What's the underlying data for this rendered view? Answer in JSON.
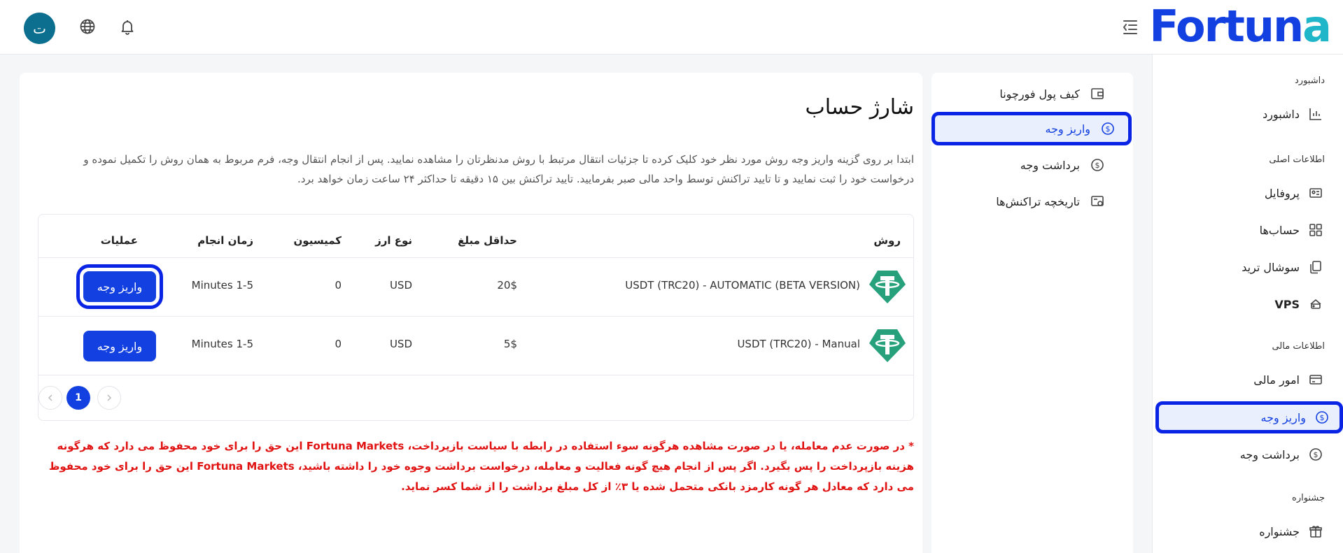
{
  "brand": {
    "logo_text": "Fortuna"
  },
  "header": {
    "avatar_glyph": "ت"
  },
  "sidebar": {
    "sections": {
      "dashboard": "داشبورد",
      "basic_info": "اطلاعات اصلی",
      "financial_info": "اطلاعات مالی",
      "festival": "جشنواره"
    },
    "items": {
      "dashboard": "داشبورد",
      "profile": "پروفایل",
      "accounts": "حساب‌ها",
      "social_trade": "سوشال ترید",
      "vps": "VPS",
      "financial_affairs": "امور مالی",
      "deposit": "واریز وجه",
      "withdraw": "برداشت وجه",
      "festival": "جشنواره"
    }
  },
  "subnav": {
    "wallet": "کیف پول فورچونا",
    "deposit": "واریز وجه",
    "withdraw": "برداشت وجه",
    "transactions": "تاریخچه تراکنش‌ها"
  },
  "page": {
    "title": "شارژ حساب",
    "description": "ابتدا بر روی گزینه واریز وجه روش مورد نظر خود کلیک کرده تا جزئیات انتقال مرتبط با روش مدنظرتان را مشاهده نمایید. پس از انجام انتقال وجه، فرم مربوط به همان روش را تکمیل نموده و درخواست خود را ثبت نمایید و تا تایید تراکنش توسط واحد مالی صبر بفرمایید. تایید تراکنش بین ۱۵ دقیقه تا حداکثر ۲۴ ساعت زمان خواهد برد.",
    "warning": "* در صورت عدم معامله، یا در صورت مشاهده هرگونه سوء استفاده در رابطه با سیاست بازپرداخت، Fortuna Markets این حق را برای خود محفوظ می دارد که هرگونه هزینه بازپرداخت را پس بگیرد. اگر پس از انجام هیچ گونه فعالیت و معامله، درخواست برداشت وجوه خود را داشته باشید، Fortuna Markets این حق را برای خود محفوظ می دارد که معادل هر گونه کارمزد بانکی متحمل شده یا ۳٪ از کل مبلغ برداشت را از شما کسر نماید."
  },
  "table": {
    "headers": {
      "method": "روش",
      "min_amount": "حداقل مبلغ",
      "currency": "نوع ارز",
      "commission": "کمیسیون",
      "time": "زمان انجام",
      "actions": "عملیات"
    },
    "rows": [
      {
        "method": "USDT (TRC20) - AUTOMATIC (BETA VERSION)",
        "min_amount": "20$",
        "currency": "USD",
        "commission": "0",
        "time": "Minutes 1-5",
        "action": "واریز وجه"
      },
      {
        "method": "USDT (TRC20) - Manual",
        "min_amount": "5$",
        "currency": "USD",
        "commission": "0",
        "time": "Minutes 1-5",
        "action": "واریز وجه"
      }
    ],
    "pagination": {
      "current": "1"
    }
  },
  "colors": {
    "primary": "#1340e0",
    "accent": "#1fb6c9",
    "highlight": "#0a24e6",
    "warning": "#e01212",
    "tether": "#26a17b"
  }
}
